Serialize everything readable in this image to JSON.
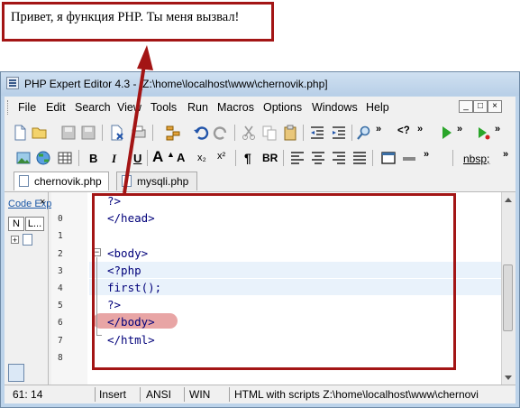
{
  "output": {
    "text": "Привет, я функция PHP. Ты меня вызвал!"
  },
  "window": {
    "title": "PHP Expert Editor 4.3 - [Z:\\home\\localhost\\www\\chernovik.php]"
  },
  "menu": [
    "File",
    "Edit",
    "Search",
    "View",
    "Tools",
    "Run",
    "Macros",
    "Options",
    "Windows",
    "Help"
  ],
  "toolbar2": {
    "bold": "B",
    "italic": "I",
    "underline": "U",
    "font_up": "A",
    "sub": "x₂",
    "sup": "x²",
    "para": "¶",
    "br": "BR",
    "nbsp": "nbsp;"
  },
  "tabs": [
    {
      "label": "chernovik.php",
      "active": true
    },
    {
      "label": "mysqli.php",
      "active": false
    }
  ],
  "left_panel": {
    "title": "Code Exp",
    "close": "×",
    "btn_n": "N",
    "btn_l": "L..."
  },
  "editor": {
    "lines": [
      {
        "num": "",
        "code": "?>"
      },
      {
        "num": "0",
        "code": "</head>"
      },
      {
        "num": "1",
        "code": ""
      },
      {
        "num": "2",
        "code": "<body>"
      },
      {
        "num": "3",
        "code": "<?php"
      },
      {
        "num": "4",
        "code": "first();"
      },
      {
        "num": "5",
        "code": "?>"
      },
      {
        "num": "6",
        "code": "</body>"
      },
      {
        "num": "7",
        "code": "</html>"
      },
      {
        "num": "8",
        "code": ""
      }
    ],
    "error_line_index": 5
  },
  "status": {
    "position": "61: 14",
    "mode": "Insert",
    "encoding": "ANSI",
    "lineend": "WIN",
    "info": "HTML with scripts Z:\\home\\localhost\\www\\chernovi"
  },
  "colors": {
    "annotation": "#a31515",
    "error_marker": "#e49595",
    "code": "#00007a"
  }
}
